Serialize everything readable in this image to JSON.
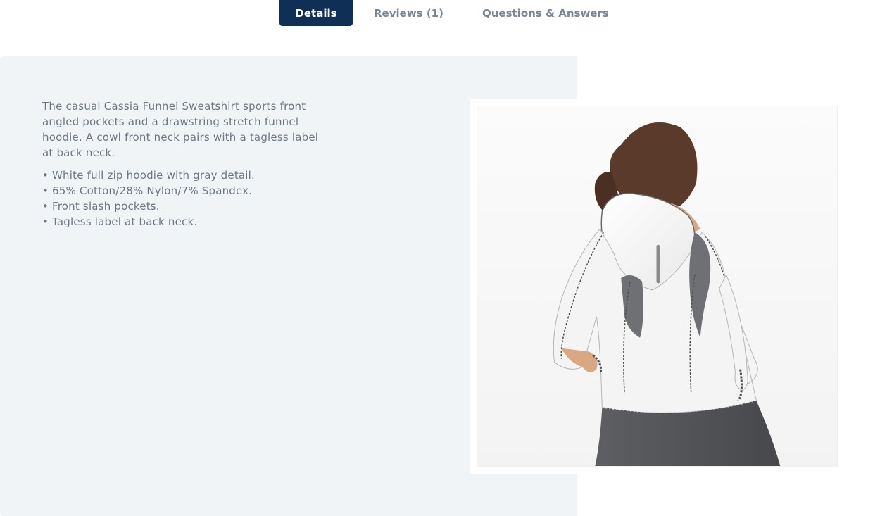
{
  "tabs": {
    "details": "Details",
    "reviews": "Reviews (1)",
    "qa": "Questions & Answers"
  },
  "details": {
    "intro": "The casual Cassia Funnel Sweatshirt sports front angled pockets and a drawstring stretch funnel hoodie. A cowl front neck pairs with a tagless label at back neck.",
    "bullets": [
      "• White full zip hoodie with gray detail.",
      "• 65% Cotton/28% Nylon/7% Spandex.",
      "• Front slash pockets.",
      "• Tagless label at back neck."
    ]
  },
  "colors": {
    "active_tab_bg": "#0f2f56",
    "tab_text": "#7a8694",
    "panel_bg": "#f1f4f7",
    "body_text": "#6c7785"
  }
}
